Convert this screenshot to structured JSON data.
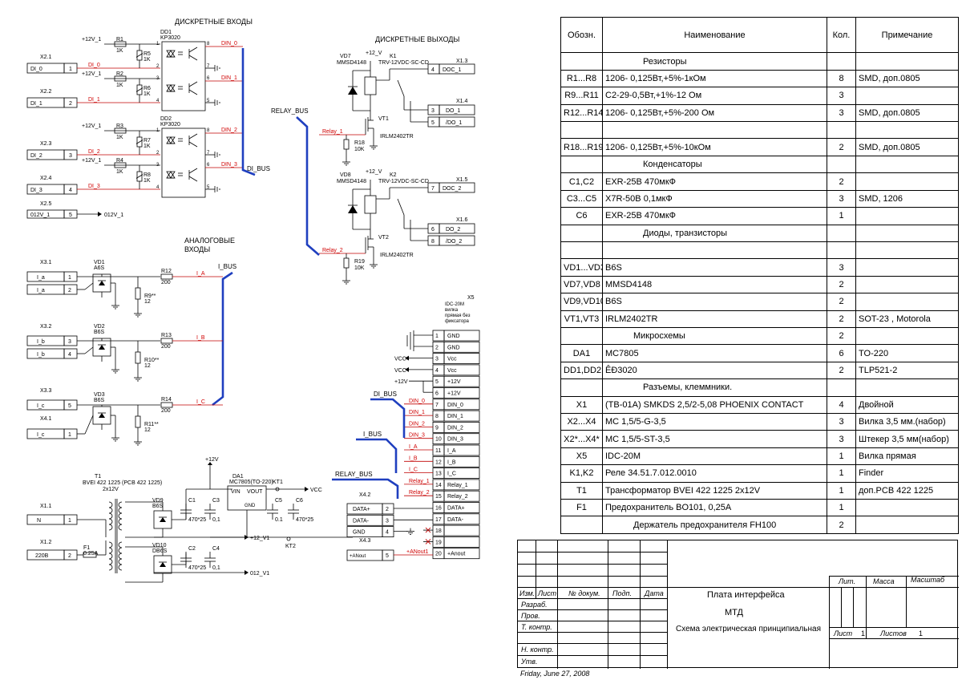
{
  "schematic": {
    "section_discrete_in": "ДИСКРЕТНЫЕ ВХОДЫ",
    "section_discrete_out": "ДИСКРЕТНЫЕ ВЫХОДЫ",
    "section_analog_line1": "АНАЛОГОВЫЕ",
    "section_analog_line2": "ВХОДЫ",
    "di_bus": "DI_BUS",
    "i_bus": "I_BUS",
    "relay_bus": "RELAY_BUS",
    "plus12": "+12V_1",
    "plus12v": "+12_V",
    "dd1": "DD1",
    "dd1_type": "KP3020",
    "dd2": "DD2",
    "dd2_type": "KP3020",
    "din": [
      "DIN_0",
      "DIN_1",
      "DIN_2",
      "DIN_3"
    ],
    "di": [
      "DI_0",
      "DI_1",
      "DI_2",
      "DI_3"
    ],
    "di_conn": [
      "X2.1",
      "X2.2",
      "X2.3",
      "X2.4",
      "X2.5"
    ],
    "r_top": [
      "R1",
      "R2",
      "R3",
      "R4"
    ],
    "r_side": [
      "R5",
      "R6",
      "R7",
      "R8"
    ],
    "r_val": "1K",
    "x25_label": "012V_1",
    "x25_pin": "5",
    "vd7": "VD7",
    "vd8": "VD8",
    "diode_type": "MMSD4148",
    "k1": "K1",
    "k2": "K2",
    "relay_type": "TRV-12VDC-SC-CD",
    "vt1": "VT1",
    "vt2": "VT2",
    "fet_type": "IRLM2402TR",
    "relay1": "Relay_1",
    "relay2": "Relay_2",
    "r18": "R18",
    "r19": "R19",
    "r10k": "10K",
    "x13": "X1.3",
    "x14": "X1.4",
    "x15": "X1.5",
    "x16": "X1.6",
    "doc1": "DOC_1",
    "do1": "DO_1",
    "ndo1": "/DO_1",
    "doc2": "DOC_2",
    "do2": "DO_2",
    "ndo2": "/DO_2",
    "analog_conn": [
      "X3.1",
      "X3.2",
      "X3.3",
      "X4.1"
    ],
    "ia": "I_a",
    "ib": "I_b",
    "ic": "I_c",
    "vd1": "VD1",
    "vd2": "VD2",
    "vd3": "VD3",
    "a6s": "A6S",
    "b6s": "B6S",
    "r12": "R12",
    "r13": "R13",
    "r14": "R14",
    "r200": "200",
    "r9": "R9**",
    "r10": "R10**",
    "r11": "R11**",
    "r12val": "12",
    "ia_net": "I_A",
    "ib_net": "I_B",
    "ic_net": "I_C",
    "x5": "X5",
    "x5_desc": [
      "IDC-20M",
      "вилка",
      "прямая без",
      "фиксатора"
    ],
    "x5_pins": [
      "GND",
      "GND",
      "Vcc",
      "Vcc",
      "+12V",
      "+12V",
      "DIN_0",
      "DIN_1",
      "DIN_2",
      "DIN_3",
      "I_A",
      "I_B",
      "I_C",
      "Relay_1",
      "Relay_2",
      "DATA+",
      "DATA-",
      "",
      "",
      "+Anout"
    ],
    "vcc": "VCC",
    "x42": "X4.2",
    "x43": "X4.3",
    "data_p": "DATA+",
    "data_m": "DATA-",
    "gnd": "GND",
    "anout": "+ANout",
    "anout1": "+ANout1",
    "t1": "T1",
    "t1_type": "BVEI 422 1225 (PCB 422 1225)",
    "t1_v": "2x12V",
    "x11": "X1.1",
    "x12": "X1.2",
    "n": "N",
    "v220": "220В",
    "f1": "F1",
    "f1_val": "0.25A",
    "vd9": "VD9",
    "vd10": "VD10",
    "db6s": "DB6S",
    "c1": "C1",
    "c2": "C2",
    "c3": "C3",
    "c4": "C4",
    "c5": "C5",
    "c6": "C6",
    "c470": "470*25",
    "c01": "0,1",
    "c01b": "0.1",
    "da1": "DA1",
    "da1_type": "MC7805(TO-220)",
    "vin": "VIN",
    "vout": "VOUT",
    "gndp": "GND",
    "kt1": "KT1",
    "kt2": "KT2",
    "plus12_v1": "+12_V1",
    "o12_v1": "012_V1",
    "plus12v_top": "+12V"
  },
  "bom": {
    "headers": [
      "Обозн.",
      "Наименование",
      "Кол.",
      "Примечание"
    ],
    "rows": [
      [
        "",
        "",
        "",
        ""
      ],
      [
        "",
        "Резисторы",
        "",
        ""
      ],
      [
        "R1...R8",
        "1206- 0,125Вт,+5%-1кОм",
        "8",
        "SMD, доп.0805"
      ],
      [
        "R9...R11",
        "C2-29-0,5Вт,+1%-12 Ом",
        "3",
        ""
      ],
      [
        "R12...R14",
        "1206- 0,125Вт,+5%-200 Ом",
        "3",
        "SMD, доп.0805"
      ],
      [
        "",
        "",
        "",
        ""
      ],
      [
        "R18...R19",
        "1206- 0,125Вт,+5%-10кОм",
        "2",
        "SMD, доп.0805"
      ],
      [
        "",
        "Конденсаторы",
        "",
        ""
      ],
      [
        "C1,C2",
        "EXR-25B 470мкФ",
        "2",
        ""
      ],
      [
        "C3...C5",
        "X7R-50B 0,1мкФ",
        "3",
        "SMD, 1206"
      ],
      [
        "C6",
        "EXR-25B 470мкФ",
        "1",
        ""
      ],
      [
        "",
        "Диоды, транзисторы",
        "",
        ""
      ],
      [
        "",
        "",
        "",
        ""
      ],
      [
        "VD1...VD3",
        "B6S",
        "3",
        ""
      ],
      [
        "VD7,VD8",
        "MMSD4148",
        "2",
        ""
      ],
      [
        "VD9,VD10",
        "B6S",
        "2",
        ""
      ],
      [
        "VT1,VT3",
        "IRLM2402TR",
        "2",
        "SOT-23 , Motorola"
      ],
      [
        "",
        "Микросхемы",
        "2",
        ""
      ],
      [
        "DA1",
        "MC7805",
        "6",
        "TO-220"
      ],
      [
        "DD1,DD2",
        "ÊÐ3020",
        "2",
        "TLP521-2"
      ],
      [
        "",
        "Разъемы, клеммники.",
        "",
        ""
      ],
      [
        "X1",
        "(TB-01A) SMKDS 2,5/2-5,08 PHOENIX CONTACT",
        "4",
        "Двойной"
      ],
      [
        "X2...X4",
        "MC 1,5/5-G-3,5",
        "3",
        "Вилка 3,5 мм.(набор)"
      ],
      [
        "X2*...X4*",
        "MC 1,5/5-ST-3,5",
        "3",
        "Штекер 3,5 мм(набор)"
      ],
      [
        "X5",
        "IDC-20M",
        "1",
        "Вилка прямая"
      ],
      [
        "K1,K2",
        "Реле 34.51.7.012.0010",
        "1",
        "Finder"
      ],
      [
        "T1",
        "Трансформатор BVEI 422 1225 2x12V",
        "1",
        "доп.PCB 422 1225"
      ],
      [
        "F1",
        "Предохранитель BO101, 0,25A",
        "1",
        ""
      ],
      [
        "",
        "Держатель предохранителя FH100",
        "2",
        ""
      ]
    ]
  },
  "stamp": {
    "izm": "Изм.",
    "list": "Лист",
    "dokum": "№ докум.",
    "podp": "Подп.",
    "data": "Дата",
    "razrab": "Разраб.",
    "prov": "Пров.",
    "tkontr": "Т. контр.",
    "nkontr": "Н. контр.",
    "utv": "Утв.",
    "title1": "Плата интерфейса",
    "title2": "МТД",
    "title3": "Схема электрическая принципиальная",
    "lit": "Лит.",
    "massa": "Масса",
    "masshtab": "Масштаб",
    "list_label": "Лист",
    "list_val": "1",
    "listov": "Листов",
    "listov_val": "1",
    "date": "Friday, June 27, 2008"
  }
}
